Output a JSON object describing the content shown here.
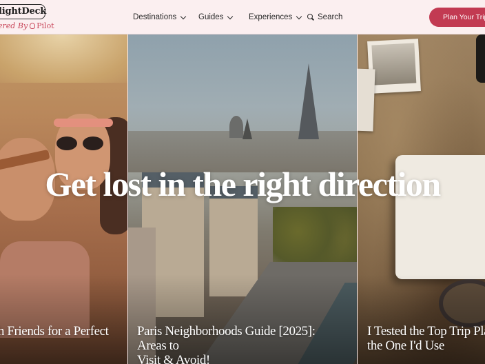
{
  "header": {
    "logo": {
      "name": "lightDeck",
      "sub_prefix": "ered By",
      "sub_brand": "Pilot"
    },
    "nav": [
      {
        "label": "Destinations",
        "icon": "chevron-down-icon"
      },
      {
        "label": "Guides",
        "icon": "chevron-down-icon"
      },
      {
        "label": "Experiences",
        "icon": "chevron-down-icon"
      }
    ],
    "search": {
      "label": "Search",
      "icon": "search-icon"
    },
    "cta": {
      "label": "Plan Your Trip"
    }
  },
  "hero": {
    "title": "Get lost in the right direction",
    "cards": [
      {
        "title_lines": [
          "th Friends for a Perfect"
        ]
      },
      {
        "title_lines": [
          "Paris Neighborhoods Guide [2025]: Areas to",
          "Visit & Avoid!"
        ]
      },
      {
        "title_lines": [
          "I Tested the Top Trip Planne",
          "the One I'd Use"
        ]
      }
    ]
  },
  "colors": {
    "accent": "#c23a52",
    "header_bg": "#fbeff0",
    "text": "#2b2b2b"
  }
}
